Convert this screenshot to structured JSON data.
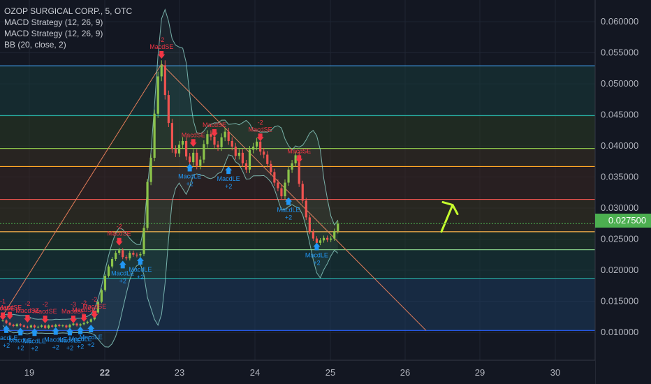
{
  "legend": {
    "title": "OZOP SURGICAL CORP., 5, OTC",
    "indicator_1": "MACD Strategy (12, 26, 9)",
    "indicator_2": "MACD Strategy (12, 26, 9)",
    "indicator_3": "BB (20, close, 2)"
  },
  "current_price_label": "0.027500",
  "colors": {
    "background": "#131722",
    "up": "#8bc34a",
    "down": "#ef5350",
    "long_signal": "#2196f3",
    "short_signal": "#f23645",
    "bb_band": "#8fd3c9",
    "arrow_annotation": "#c6ff2e",
    "price_tag": "#4caf50"
  },
  "chart_data": {
    "type": "line",
    "y_axis": {
      "ticks": [
        "0.060000",
        "0.055000",
        "0.050000",
        "0.045000",
        "0.040000",
        "0.035000",
        "0.030000",
        "0.025000",
        "0.020000",
        "0.015000",
        "0.010000"
      ],
      "range": [
        0.0055,
        0.0635
      ]
    },
    "x_axis": {
      "ticks": [
        "19",
        "22",
        "23",
        "24",
        "25",
        "26",
        "29",
        "30"
      ],
      "bold_ticks": [
        "22"
      ]
    },
    "fib_levels": [
      0.0103,
      0.0187,
      0.0233,
      0.0262,
      0.0314,
      0.0367,
      0.0396,
      0.0449,
      0.0529
    ],
    "current_price": 0.0275,
    "series": [
      {
        "x": [
          0,
          1,
          2,
          3,
          4,
          5,
          6,
          7,
          8,
          9,
          10,
          11,
          12,
          13,
          14,
          15,
          16,
          17,
          18,
          19,
          20,
          21,
          22,
          23,
          24,
          25,
          26,
          27,
          28,
          29,
          30,
          31,
          32,
          33,
          34,
          35,
          36,
          37,
          38,
          39,
          40,
          41,
          42,
          43,
          44,
          45,
          46,
          47,
          48,
          49,
          50,
          51,
          52,
          53,
          54,
          55,
          56,
          57,
          58,
          59,
          60,
          61,
          62,
          63,
          64,
          65,
          66,
          67,
          68,
          69,
          70,
          71,
          72,
          73,
          74,
          75,
          76,
          77,
          78,
          79,
          80,
          81,
          82,
          83,
          84,
          85,
          86,
          87,
          88,
          89,
          90,
          91,
          92,
          93,
          94,
          95,
          96,
          97,
          98,
          99,
          100,
          101,
          102,
          103,
          104,
          105,
          106,
          107,
          108,
          109,
          110,
          111,
          112,
          113,
          114,
          115,
          116,
          117,
          118,
          119,
          120,
          121,
          122,
          123,
          124,
          125
        ],
        "values": [
          0.0119,
          0.0115,
          0.0112,
          0.011,
          0.0113,
          0.0111,
          0.0109,
          0.0108,
          0.0111,
          0.0108,
          0.0109,
          0.0111,
          0.0107,
          0.0111,
          0.0109,
          0.0112,
          0.011,
          0.0111,
          0.0108,
          0.0112,
          0.0114,
          0.0111,
          0.0113,
          0.0115,
          0.0117,
          0.0121,
          0.0132,
          0.0149,
          0.0168,
          0.0191,
          0.0206,
          0.0218,
          0.0228,
          0.0232,
          0.0221,
          0.0219,
          0.0228,
          0.0225,
          0.0224,
          0.0226,
          0.0268,
          0.0342,
          0.0381,
          0.0452,
          0.0512,
          0.053,
          0.0482,
          0.0437,
          0.0395,
          0.0388,
          0.0402,
          0.0408,
          0.0383,
          0.0374,
          0.0389,
          0.0368,
          0.0378,
          0.0403,
          0.0419,
          0.0415,
          0.0402,
          0.0398,
          0.0414,
          0.0423,
          0.0408,
          0.0399,
          0.0384,
          0.0389,
          0.0372,
          0.0362,
          0.0394,
          0.0399,
          0.0407,
          0.0391,
          0.0386,
          0.0371,
          0.0358,
          0.0341,
          0.0332,
          0.0319,
          0.0341,
          0.0362,
          0.0372,
          0.0385,
          0.0339,
          0.0312,
          0.0285,
          0.0262,
          0.0251,
          0.0244,
          0.0248,
          0.0252,
          0.0249,
          0.0251,
          0.0263,
          0.0275,
          0.0275,
          0.0275,
          0.0275,
          0.0275,
          0.0275,
          0.0275,
          0.0275,
          0.0275,
          0.0275,
          0.0275,
          0.0275,
          0.0275,
          0.0275,
          0.0275,
          0.0275,
          0.0275,
          0.0275,
          0.0275,
          0.0275,
          0.0275,
          0.0275,
          0.0275,
          0.0275,
          0.0275,
          0.0275,
          0.0275,
          0.0275,
          0.0275,
          0.0275,
          0.0275
        ]
      }
    ]
  },
  "signals": {
    "short": [
      {
        "bar": 0,
        "price": 0.0123,
        "labels": [
          "-1",
          "MacdSE"
        ]
      },
      {
        "bar": 2,
        "price": 0.0124,
        "labels": [
          "MacdSE"
        ]
      },
      {
        "bar": 7,
        "price": 0.0119,
        "labels": [
          "-2",
          "MacdSE"
        ]
      },
      {
        "bar": 12,
        "price": 0.0118,
        "labels": [
          "-2",
          "MacdSE"
        ]
      },
      {
        "bar": 20,
        "price": 0.0118,
        "labels": [
          "-3",
          "MacdSE"
        ]
      },
      {
        "bar": 23,
        "price": 0.012,
        "labels": [
          "-2",
          "MacdSE"
        ]
      },
      {
        "bar": 26,
        "price": 0.0126,
        "labels": [
          "-2",
          "MacdSE"
        ]
      },
      {
        "bar": 33,
        "price": 0.0243,
        "labels": [
          "-2",
          "MacdSE"
        ]
      },
      {
        "bar": 45,
        "price": 0.0544,
        "labels": [
          "-2",
          "MacdSE"
        ]
      },
      {
        "bar": 54,
        "price": 0.0402,
        "labels": [
          "MacdSE"
        ]
      },
      {
        "bar": 60,
        "price": 0.0418,
        "labels": [
          "MacdSE"
        ]
      },
      {
        "bar": 73,
        "price": 0.0411,
        "labels": [
          "-2",
          "MacdSE"
        ]
      },
      {
        "bar": 84,
        "price": 0.0376,
        "labels": [
          "MacdSE"
        ]
      }
    ],
    "long": [
      {
        "bar": 1,
        "price": 0.0108,
        "labels": [
          "MacdLE",
          "+2"
        ]
      },
      {
        "bar": 5,
        "price": 0.0104,
        "labels": [
          "MacdLE",
          "+2"
        ]
      },
      {
        "bar": 9,
        "price": 0.0103,
        "labels": [
          "MacdLE",
          "+2"
        ]
      },
      {
        "bar": 15,
        "price": 0.0105,
        "labels": [
          "MacdLE",
          "+2"
        ]
      },
      {
        "bar": 19,
        "price": 0.0104,
        "labels": [
          "MacdLE",
          "+2"
        ]
      },
      {
        "bar": 22,
        "price": 0.0106,
        "labels": [
          "MacdLE",
          "+2"
        ]
      },
      {
        "bar": 25,
        "price": 0.0109,
        "labels": [
          "MacdLE",
          "+2"
        ]
      },
      {
        "bar": 34,
        "price": 0.0212,
        "labels": [
          "MacdLE",
          "+2"
        ]
      },
      {
        "bar": 39,
        "price": 0.0218,
        "labels": [
          "MacdLE",
          "+2"
        ]
      },
      {
        "bar": 53,
        "price": 0.0368,
        "labels": [
          "MacdLE",
          "+2"
        ]
      },
      {
        "bar": 64,
        "price": 0.0364,
        "labels": [
          "MacdLE",
          "+2"
        ]
      },
      {
        "bar": 81,
        "price": 0.0314,
        "labels": [
          "MacdLE",
          "+2"
        ]
      },
      {
        "bar": 89,
        "price": 0.0241,
        "labels": [
          "MacdLE",
          "+2"
        ]
      }
    ]
  }
}
